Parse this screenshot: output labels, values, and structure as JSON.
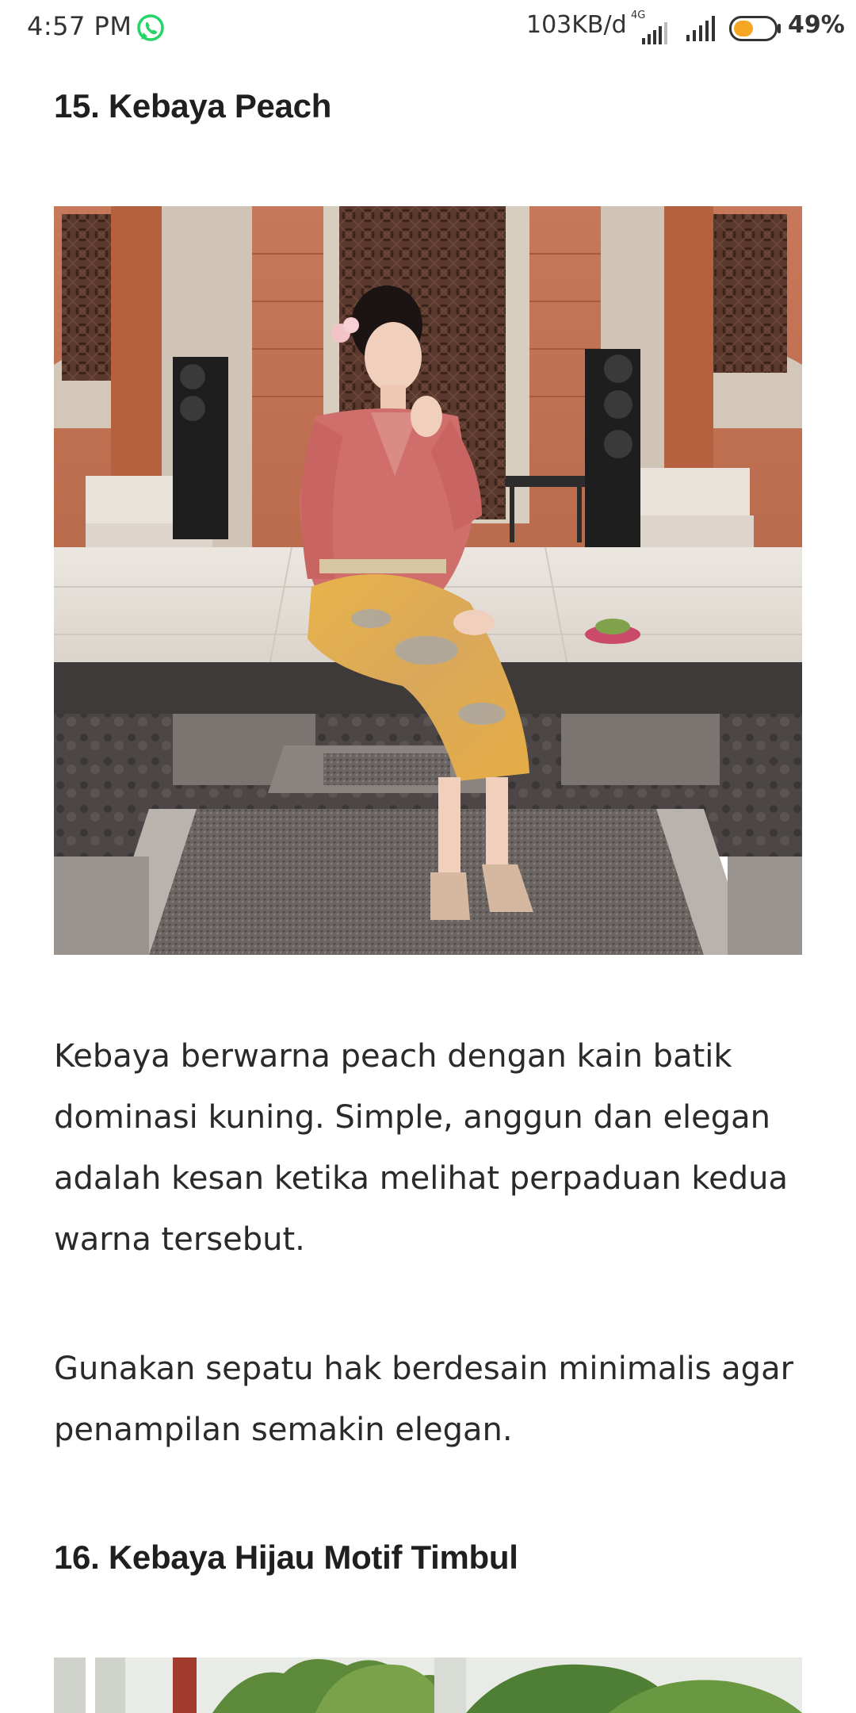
{
  "status_bar": {
    "time": "4:57 PM",
    "notification_icon": "whatsapp-icon",
    "net_speed": "103KB/d",
    "network_type": "4G",
    "battery_percent": "49%",
    "battery_level": 0.49,
    "battery_color": "#f5a623"
  },
  "article": {
    "section_15": {
      "heading": "15. Kebaya Peach",
      "image_icon": "photo-kebaya-peach",
      "paragraphs": [
        "Kebaya berwarna peach dengan kain batik dominasi kuning. Simple, anggun dan elegan adalah kesan ketika melihat perpaduan kedua warna tersebut.",
        "Gunakan sepatu hak berdesain minimalis agar penampilan semakin elegan."
      ]
    },
    "section_16": {
      "heading": "16. Kebaya Hijau Motif Timbul",
      "image_icon": "photo-kebaya-hijau"
    }
  },
  "colors": {
    "accent_whatsapp": "#25d366",
    "text_primary": "#222222"
  }
}
